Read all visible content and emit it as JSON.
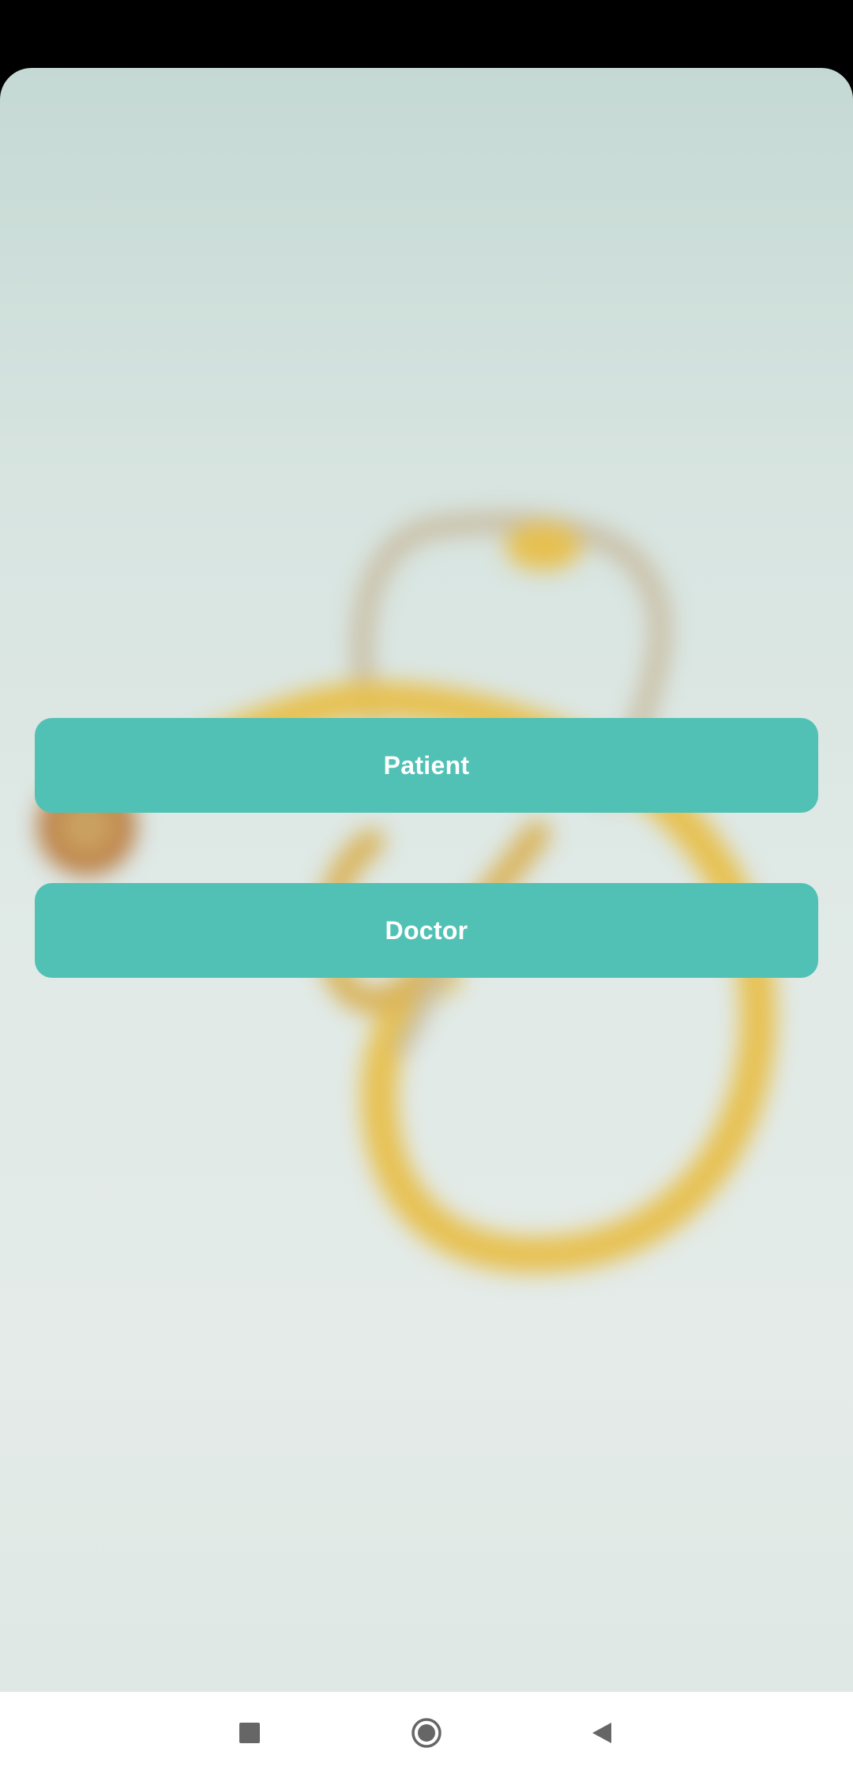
{
  "buttons": {
    "patient_label": "Patient",
    "doctor_label": "Doctor"
  },
  "colors": {
    "button_bg": "#52c1b5",
    "button_text": "#ffffff",
    "stethoscope_tube": "#e7c04f",
    "nav_icon": "#666666"
  },
  "background": {
    "image": "blurred-stethoscope-photo"
  },
  "nav_bar": {
    "icons": [
      "recents-icon",
      "home-icon",
      "back-icon"
    ]
  }
}
